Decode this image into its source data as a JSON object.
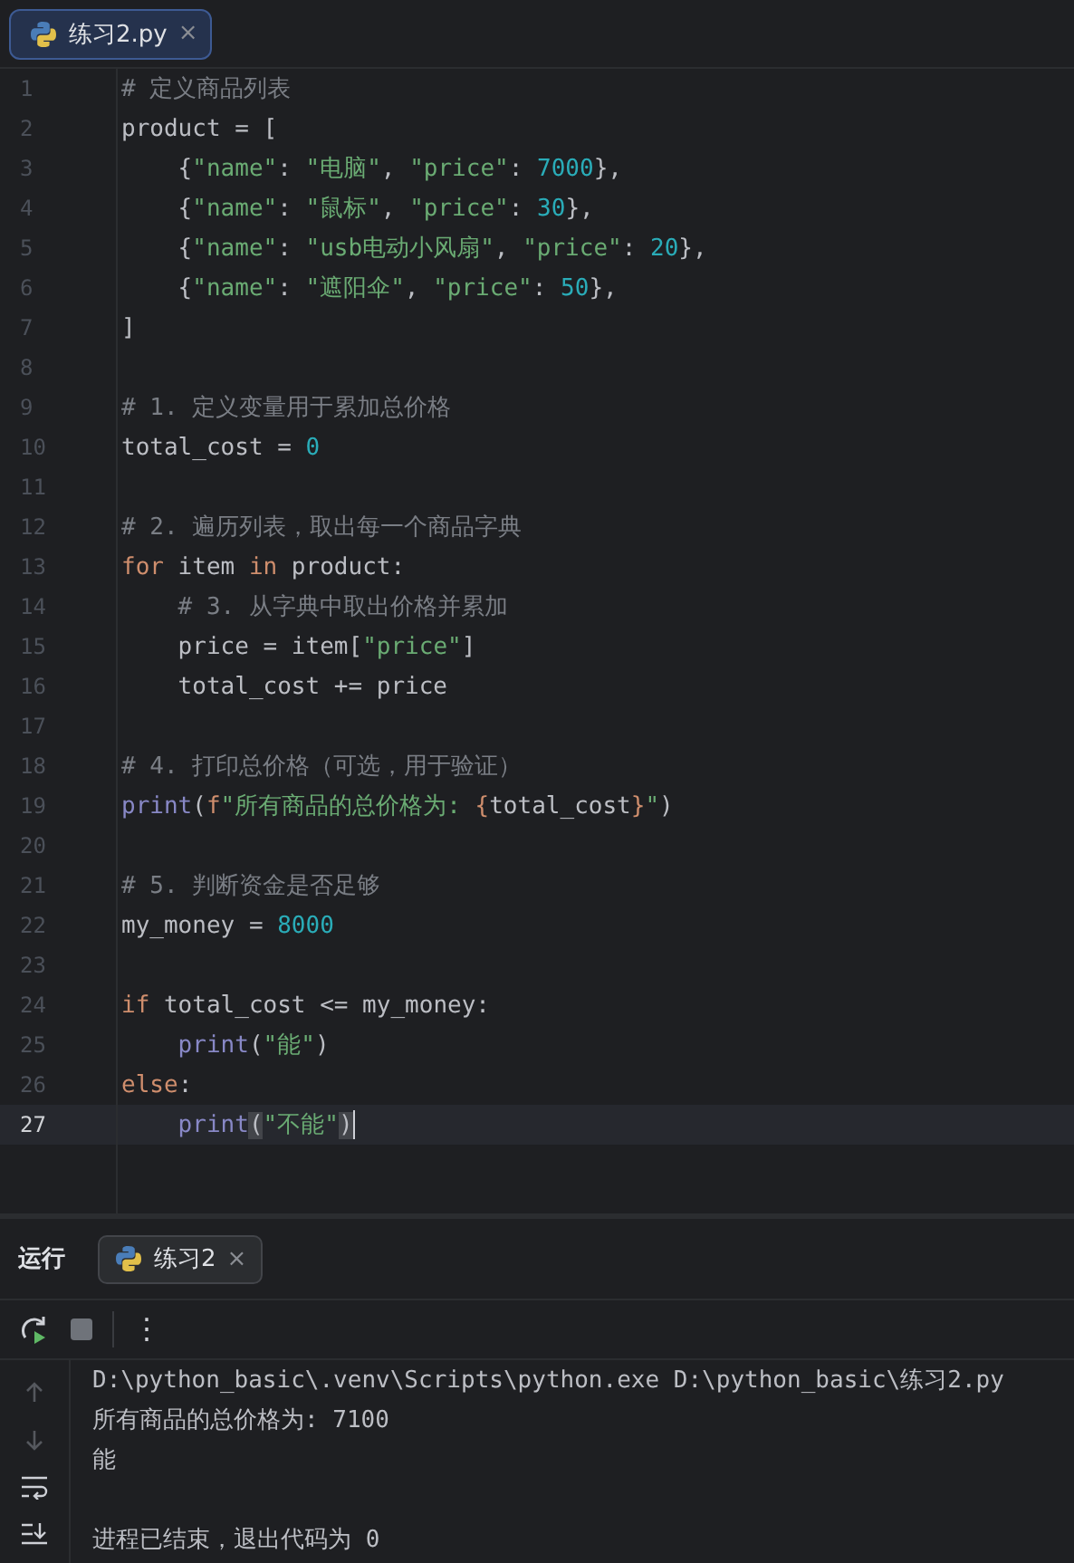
{
  "editor_tabs": [
    {
      "label": "练习2.py",
      "selected": true,
      "close": "×"
    }
  ],
  "lines": [
    {
      "number": "1",
      "current": false,
      "tokens": [
        {
          "kind": "comment",
          "text": "# 定义商品列表"
        }
      ]
    },
    {
      "number": "2",
      "current": false,
      "tokens": [
        {
          "kind": "plain",
          "text": "product = ["
        }
      ]
    },
    {
      "number": "3",
      "current": false,
      "tokens": [
        {
          "kind": "plain",
          "text": "    {"
        },
        {
          "kind": "string",
          "text": "\"name\""
        },
        {
          "kind": "plain",
          "text": ": "
        },
        {
          "kind": "string",
          "text": "\"电脑\""
        },
        {
          "kind": "plain",
          "text": ", "
        },
        {
          "kind": "string",
          "text": "\"price\""
        },
        {
          "kind": "plain",
          "text": ": "
        },
        {
          "kind": "number",
          "text": "7000"
        },
        {
          "kind": "plain",
          "text": "},"
        }
      ]
    },
    {
      "number": "4",
      "current": false,
      "tokens": [
        {
          "kind": "plain",
          "text": "    {"
        },
        {
          "kind": "string",
          "text": "\"name\""
        },
        {
          "kind": "plain",
          "text": ": "
        },
        {
          "kind": "string",
          "text": "\"鼠标\""
        },
        {
          "kind": "plain",
          "text": ", "
        },
        {
          "kind": "string",
          "text": "\"price\""
        },
        {
          "kind": "plain",
          "text": ": "
        },
        {
          "kind": "number",
          "text": "30"
        },
        {
          "kind": "plain",
          "text": "},"
        }
      ]
    },
    {
      "number": "5",
      "current": false,
      "tokens": [
        {
          "kind": "plain",
          "text": "    {"
        },
        {
          "kind": "string",
          "text": "\"name\""
        },
        {
          "kind": "plain",
          "text": ": "
        },
        {
          "kind": "string",
          "text": "\"usb电动小风扇\""
        },
        {
          "kind": "plain",
          "text": ", "
        },
        {
          "kind": "string",
          "text": "\"price\""
        },
        {
          "kind": "plain",
          "text": ": "
        },
        {
          "kind": "number",
          "text": "20"
        },
        {
          "kind": "plain",
          "text": "},"
        }
      ]
    },
    {
      "number": "6",
      "current": false,
      "tokens": [
        {
          "kind": "plain",
          "text": "    {"
        },
        {
          "kind": "string",
          "text": "\"name\""
        },
        {
          "kind": "plain",
          "text": ": "
        },
        {
          "kind": "string",
          "text": "\"遮阳伞\""
        },
        {
          "kind": "plain",
          "text": ", "
        },
        {
          "kind": "string",
          "text": "\"price\""
        },
        {
          "kind": "plain",
          "text": ": "
        },
        {
          "kind": "number",
          "text": "50"
        },
        {
          "kind": "plain",
          "text": "},"
        }
      ]
    },
    {
      "number": "7",
      "current": false,
      "tokens": [
        {
          "kind": "plain",
          "text": "]"
        }
      ]
    },
    {
      "number": "8",
      "current": false
    },
    {
      "number": "9",
      "current": false,
      "tokens": [
        {
          "kind": "comment",
          "text": "# 1. 定义变量用于累加总价格"
        }
      ]
    },
    {
      "number": "10",
      "current": false,
      "tokens": [
        {
          "kind": "plain",
          "text": "total_cost = "
        },
        {
          "kind": "number",
          "text": "0"
        }
      ]
    },
    {
      "number": "11",
      "current": false
    },
    {
      "number": "12",
      "current": false,
      "tokens": [
        {
          "kind": "comment",
          "text": "# 2. 遍历列表，取出每一个商品字典"
        }
      ]
    },
    {
      "number": "13",
      "current": false,
      "tokens": [
        {
          "kind": "keyword",
          "text": "for"
        },
        {
          "kind": "plain",
          "text": " item "
        },
        {
          "kind": "keyword",
          "text": "in"
        },
        {
          "kind": "plain",
          "text": " product:"
        }
      ]
    },
    {
      "number": "14",
      "current": false,
      "tokens": [
        {
          "kind": "comment",
          "text": "    # 3. 从字典中取出价格并累加"
        }
      ]
    },
    {
      "number": "15",
      "current": false,
      "tokens": [
        {
          "kind": "plain",
          "text": "    price = item["
        },
        {
          "kind": "string",
          "text": "\"price\""
        },
        {
          "kind": "plain",
          "text": "]"
        }
      ]
    },
    {
      "number": "16",
      "current": false,
      "tokens": [
        {
          "kind": "plain",
          "text": "    total_cost += price"
        }
      ]
    },
    {
      "number": "17",
      "current": false
    },
    {
      "number": "18",
      "current": false,
      "tokens": [
        {
          "kind": "comment",
          "text": "# 4. 打印总价格（可选，用于验证）"
        }
      ]
    },
    {
      "number": "19",
      "current": false,
      "tokens": [
        {
          "kind": "builtin",
          "text": "print"
        },
        {
          "kind": "plain",
          "text": "("
        },
        {
          "kind": "brace",
          "text": "f"
        },
        {
          "kind": "string",
          "text": "\"所有商品的总价格为: "
        },
        {
          "kind": "brace",
          "text": "{"
        },
        {
          "kind": "plain",
          "text": "total_cost"
        },
        {
          "kind": "brace",
          "text": "}"
        },
        {
          "kind": "string",
          "text": "\""
        },
        {
          "kind": "plain",
          "text": ")"
        }
      ]
    },
    {
      "number": "20",
      "current": false
    },
    {
      "number": "21",
      "current": false,
      "tokens": [
        {
          "kind": "comment",
          "text": "# 5. 判断资金是否足够"
        }
      ]
    },
    {
      "number": "22",
      "current": false,
      "tokens": [
        {
          "kind": "plain",
          "text": "my_money = "
        },
        {
          "kind": "number",
          "text": "8000"
        }
      ]
    },
    {
      "number": "23",
      "current": false
    },
    {
      "number": "24",
      "current": false,
      "tokens": [
        {
          "kind": "keyword",
          "text": "if"
        },
        {
          "kind": "plain",
          "text": " total_cost <= my_money:"
        }
      ]
    },
    {
      "number": "25",
      "current": false,
      "tokens": [
        {
          "kind": "builtin",
          "text": "    print"
        },
        {
          "kind": "plain",
          "text": "("
        },
        {
          "kind": "string",
          "text": "\"能\""
        },
        {
          "kind": "plain",
          "text": ")"
        }
      ]
    },
    {
      "number": "26",
      "current": false,
      "tokens": [
        {
          "kind": "keyword",
          "text": "else"
        },
        {
          "kind": "plain",
          "text": ":"
        }
      ]
    },
    {
      "number": "27",
      "current": true,
      "tokens": [
        {
          "kind": "builtin",
          "text": "    print"
        },
        {
          "kind": "match",
          "text": "("
        },
        {
          "kind": "string",
          "text": "\"不能\""
        },
        {
          "kind": "match",
          "text": ")"
        }
      ]
    }
  ],
  "run_panel": {
    "title": "运行",
    "tabs": [
      {
        "label": "练习2",
        "selected": true,
        "close": "×"
      }
    ],
    "more": "⋮",
    "side_buttons": [
      {
        "kind": "up",
        "disabled": true
      },
      {
        "kind": "down",
        "disabled": true
      },
      {
        "kind": "wrap",
        "disabled": false
      },
      {
        "kind": "scroll-end",
        "disabled": false
      }
    ],
    "output": [
      {
        "kind": "stdout",
        "text": "D:\\python_basic\\.venv\\Scripts\\python.exe D:\\python_basic\\练习2.py"
      },
      {
        "kind": "stdout",
        "text": "所有商品的总价格为: 7100"
      },
      {
        "kind": "stdout",
        "text": "能"
      },
      {
        "kind": "exit",
        "text": "进程已结束，退出代码为 0"
      }
    ]
  }
}
